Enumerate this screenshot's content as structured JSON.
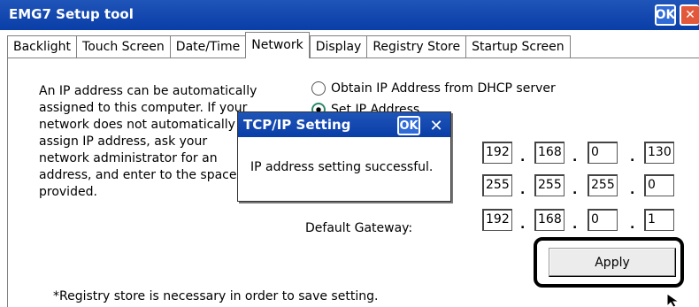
{
  "window": {
    "title": "EMG7 Setup tool",
    "ok_label": "OK",
    "close_label": "✕"
  },
  "tabs": [
    {
      "label": "Backlight"
    },
    {
      "label": "Touch Screen"
    },
    {
      "label": "Date/Time"
    },
    {
      "label": "Network"
    },
    {
      "label": "Display"
    },
    {
      "label": "Registry Store"
    },
    {
      "label": "Startup Screen"
    }
  ],
  "active_tab": "Network",
  "network": {
    "description": "An IP address can be automatically assigned to this computer. If your network does not automatically assign IP address, ask your network administrator for an address, and enter to the space provided.",
    "dhcp_label": "Obtain IP Address from DHCP server",
    "static_label": "Set IP Address",
    "ip": [
      "192",
      "168",
      "0",
      "130"
    ],
    "mask": [
      "255",
      "255",
      "255",
      "0"
    ],
    "gateway_label": "Default Gateway:",
    "gateway": [
      "192",
      "168",
      "0",
      "1"
    ],
    "apply_label": "Apply",
    "footnote": "*Registry store is necessary in order to save setting."
  },
  "dialog": {
    "title": "TCP/IP Setting",
    "ok_label": "OK",
    "close_label": "✕",
    "message": "IP address setting successful."
  },
  "colors": {
    "titlebar": "#0a3ea8",
    "close_button": "#e1583a",
    "highlight_frame": "#000000"
  }
}
